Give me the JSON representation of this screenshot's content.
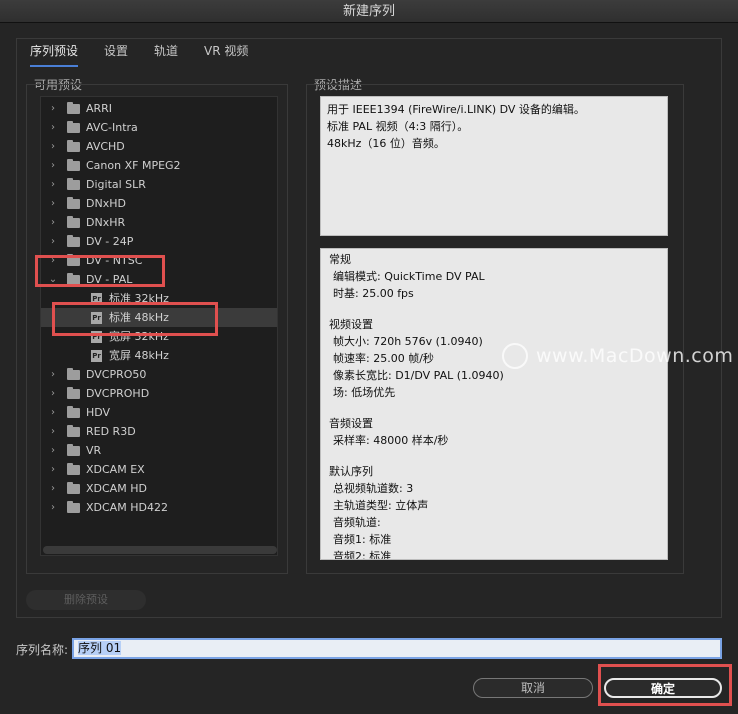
{
  "window": {
    "title": "新建序列"
  },
  "tabs": [
    {
      "label": "序列预设",
      "active": true
    },
    {
      "label": "设置"
    },
    {
      "label": "轨道"
    },
    {
      "label": "VR 视频"
    }
  ],
  "presets": {
    "title": "可用预设",
    "items": [
      {
        "label": "ARRI",
        "type": "folder",
        "expanded": false
      },
      {
        "label": "AVC-Intra",
        "type": "folder",
        "expanded": false
      },
      {
        "label": "AVCHD",
        "type": "folder",
        "expanded": false
      },
      {
        "label": "Canon XF MPEG2",
        "type": "folder",
        "expanded": false
      },
      {
        "label": "Digital SLR",
        "type": "folder",
        "expanded": false
      },
      {
        "label": "DNxHD",
        "type": "folder",
        "expanded": false
      },
      {
        "label": "DNxHR",
        "type": "folder",
        "expanded": false
      },
      {
        "label": "DV - 24P",
        "type": "folder",
        "expanded": false
      },
      {
        "label": "DV - NTSC",
        "type": "folder",
        "expanded": false
      },
      {
        "label": "DV - PAL",
        "type": "folder",
        "expanded": true
      },
      {
        "label": "标准 32kHz",
        "type": "preset"
      },
      {
        "label": "标准 48kHz",
        "type": "preset",
        "selected": true
      },
      {
        "label": "宽屏 32kHz",
        "type": "preset"
      },
      {
        "label": "宽屏 48kHz",
        "type": "preset"
      },
      {
        "label": "DVCPRO50",
        "type": "folder",
        "expanded": false
      },
      {
        "label": "DVCPROHD",
        "type": "folder",
        "expanded": false
      },
      {
        "label": "HDV",
        "type": "folder",
        "expanded": false
      },
      {
        "label": "RED R3D",
        "type": "folder",
        "expanded": false
      },
      {
        "label": "VR",
        "type": "folder",
        "expanded": false
      },
      {
        "label": "XDCAM EX",
        "type": "folder",
        "expanded": false
      },
      {
        "label": "XDCAM HD",
        "type": "folder",
        "expanded": false
      },
      {
        "label": "XDCAM HD422",
        "type": "folder",
        "expanded": false
      }
    ],
    "delete_label": "删除预设"
  },
  "description": {
    "title": "预设描述",
    "summary": [
      "用于 IEEE1394 (FireWire/i.LINK) DV 设备的编辑。",
      "标准 PAL 视频（4:3 隔行）。",
      "48kHz（16 位）音频。"
    ],
    "details": [
      {
        "text": "常规",
        "indent": false
      },
      {
        "text": "编辑模式: QuickTime DV PAL",
        "indent": true
      },
      {
        "text": "时基: 25.00 fps",
        "indent": true
      },
      {
        "gap": true
      },
      {
        "text": "视频设置",
        "indent": false
      },
      {
        "text": "帧大小: 720h 576v (1.0940)",
        "indent": true
      },
      {
        "text": "帧速率: 25.00  帧/秒",
        "indent": true
      },
      {
        "text": "像素长宽比: D1/DV PAL (1.0940)",
        "indent": true
      },
      {
        "text": "场: 低场优先",
        "indent": true
      },
      {
        "gap": true
      },
      {
        "text": "音频设置",
        "indent": false
      },
      {
        "text": "采样率: 48000 样本/秒",
        "indent": true
      },
      {
        "gap": true
      },
      {
        "text": "默认序列",
        "indent": false
      },
      {
        "text": "总视频轨道数: 3",
        "indent": true
      },
      {
        "text": "主轨道类型: 立体声",
        "indent": true
      },
      {
        "text": "音频轨道:",
        "indent": true
      },
      {
        "text": "音频1: 标准",
        "indent": true
      },
      {
        "text": "音频2: 标准",
        "indent": true
      }
    ]
  },
  "sequence_name": {
    "label": "序列名称:",
    "value": "序列 01"
  },
  "buttons": {
    "cancel": "取消",
    "ok": "确定"
  },
  "watermark": {
    "text": "www.MacDown.com"
  },
  "colors": {
    "highlight": "#e0504f",
    "accent": "#4a7fd6"
  }
}
